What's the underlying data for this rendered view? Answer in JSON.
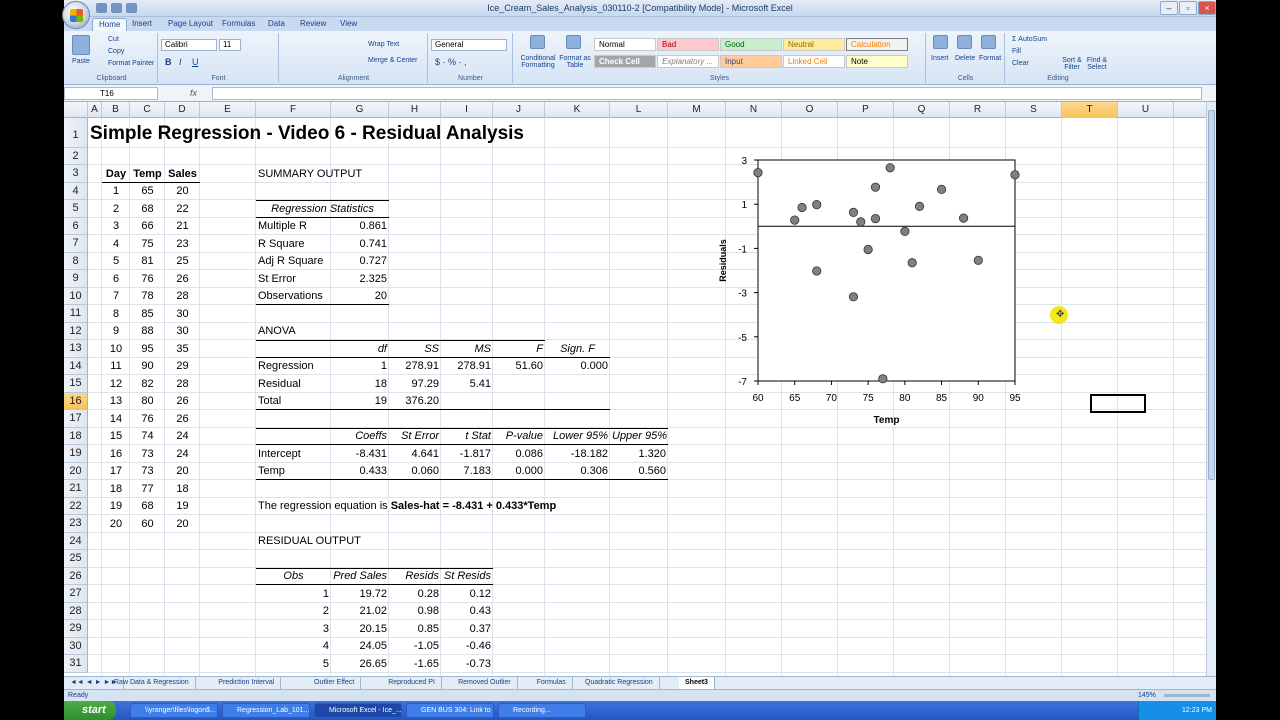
{
  "window": {
    "title": "Ice_Cream_Sales_Analysis_030110-2  [Compatibility Mode] - Microsoft Excel"
  },
  "ribbon_tabs": [
    "Home",
    "Insert",
    "Page Layout",
    "Formulas",
    "Data",
    "Review",
    "View"
  ],
  "ribbon": {
    "clipboard": {
      "paste": "Paste",
      "cut": "Cut",
      "copy": "Copy",
      "format_painter": "Format Painter",
      "label": "Clipboard"
    },
    "font": {
      "name": "Calibri",
      "size": "11",
      "label": "Font"
    },
    "alignment": {
      "wrap": "Wrap Text",
      "merge": "Merge & Center",
      "label": "Alignment"
    },
    "number": {
      "format": "General",
      "label": "Number"
    },
    "styles": {
      "conditional": "Conditional Formatting",
      "format_table": "Format as Table",
      "label": "Styles",
      "cells": [
        "Normal",
        "Bad",
        "Good",
        "Neutral",
        "Calculation",
        "Check Cell",
        "Explanatory ...",
        "Input",
        "Linked Cell",
        "Note"
      ]
    },
    "cells": {
      "insert": "Insert",
      "delete": "Delete",
      "format": "Format",
      "label": "Cells"
    },
    "editing": {
      "autosum": "AutoSum",
      "fill": "Fill",
      "clear": "Clear",
      "sort": "Sort & Filter",
      "find": "Find & Select",
      "label": "Editing"
    }
  },
  "formula_bar": {
    "name_box": "T16",
    "fx": "fx",
    "value": ""
  },
  "columns": [
    "A",
    "B",
    "C",
    "D",
    "E",
    "F",
    "G",
    "H",
    "I",
    "J",
    "K",
    "L",
    "M",
    "N",
    "O",
    "P",
    "Q",
    "R",
    "S",
    "T",
    "U"
  ],
  "selected_column": "T",
  "rows": [
    "1",
    "2",
    "3",
    "4",
    "5",
    "6",
    "7",
    "8",
    "9",
    "10",
    "11",
    "12",
    "13",
    "14",
    "15",
    "16",
    "17",
    "18",
    "19",
    "20",
    "21",
    "22",
    "23",
    "24",
    "25",
    "26",
    "27",
    "28",
    "29",
    "30",
    "31"
  ],
  "selected_row": "16",
  "sheet": {
    "title": "Simple Regression - Video 6 - Residual Analysis",
    "data_headers": [
      "Day",
      "Temp",
      "Sales"
    ],
    "data": [
      [
        "1",
        "65",
        "20"
      ],
      [
        "2",
        "68",
        "22"
      ],
      [
        "3",
        "66",
        "21"
      ],
      [
        "4",
        "75",
        "23"
      ],
      [
        "5",
        "81",
        "25"
      ],
      [
        "6",
        "76",
        "26"
      ],
      [
        "7",
        "78",
        "28"
      ],
      [
        "8",
        "85",
        "30"
      ],
      [
        "9",
        "88",
        "30"
      ],
      [
        "10",
        "95",
        "35"
      ],
      [
        "11",
        "90",
        "29"
      ],
      [
        "12",
        "82",
        "28"
      ],
      [
        "13",
        "80",
        "26"
      ],
      [
        "14",
        "76",
        "26"
      ],
      [
        "15",
        "74",
        "24"
      ],
      [
        "16",
        "73",
        "24"
      ],
      [
        "17",
        "73",
        "20"
      ],
      [
        "18",
        "77",
        "18"
      ],
      [
        "19",
        "68",
        "19"
      ],
      [
        "20",
        "60",
        "20"
      ]
    ],
    "summary_title": "SUMMARY OUTPUT",
    "reg_stats_title": "Regression Statistics",
    "reg_stats": [
      [
        "Multiple R",
        "0.861"
      ],
      [
        "R Square",
        "0.741"
      ],
      [
        "Adj R Square",
        "0.727"
      ],
      [
        "St Error",
        "2.325"
      ],
      [
        "Observations",
        "20"
      ]
    ],
    "anova_title": "ANOVA",
    "anova_headers": [
      "df",
      "SS",
      "MS",
      "F",
      "Sign. F"
    ],
    "anova": [
      [
        "Regression",
        "1",
        "278.91",
        "278.91",
        "51.60",
        "0.000"
      ],
      [
        "Residual",
        "18",
        "97.29",
        "5.41",
        "",
        ""
      ],
      [
        "Total",
        "19",
        "376.20",
        "",
        "",
        ""
      ]
    ],
    "coef_headers": [
      "Coeffs",
      "St Error",
      "t Stat",
      "P-value",
      "Lower 95%",
      "Upper 95%"
    ],
    "coefs": [
      [
        "Intercept",
        "-8.431",
        "4.641",
        "-1.817",
        "0.086",
        "-18.182",
        "1.320"
      ],
      [
        "Temp",
        "0.433",
        "0.060",
        "7.183",
        "0.000",
        "0.306",
        "0.560"
      ]
    ],
    "equation_prefix": "The regression equation is ",
    "equation": "Sales-hat = -8.431 + 0.433*Temp",
    "residual_title": "RESIDUAL OUTPUT",
    "residual_headers": [
      "Obs",
      "Pred Sales",
      "Resids",
      "St Resids"
    ],
    "residuals": [
      [
        "1",
        "19.72",
        "0.28",
        "0.12"
      ],
      [
        "2",
        "21.02",
        "0.98",
        "0.43"
      ],
      [
        "3",
        "20.15",
        "0.85",
        "0.37"
      ],
      [
        "4",
        "24.05",
        "-1.05",
        "-0.46"
      ],
      [
        "5",
        "26.65",
        "-1.65",
        "-0.73"
      ]
    ]
  },
  "chart_data": {
    "type": "scatter",
    "title": "",
    "xlabel": "Temp",
    "ylabel": "Residuals",
    "xlim": [
      60,
      95
    ],
    "ylim": [
      -7,
      3
    ],
    "xticks": [
      "60",
      "65",
      "70",
      "75",
      "80",
      "85",
      "90",
      "95"
    ],
    "yticks": [
      "3",
      "1",
      "-1",
      "-3",
      "-5",
      "-7"
    ],
    "points": [
      [
        65,
        0.28
      ],
      [
        68,
        0.98
      ],
      [
        66,
        0.85
      ],
      [
        75,
        -1.05
      ],
      [
        81,
        -1.65
      ],
      [
        76,
        0.35
      ],
      [
        78,
        2.65
      ],
      [
        85,
        1.67
      ],
      [
        88,
        0.37
      ],
      [
        95,
        2.33
      ],
      [
        90,
        -1.54
      ],
      [
        82,
        0.9
      ],
      [
        80,
        -0.23
      ],
      [
        76,
        1.77
      ],
      [
        74,
        0.2
      ],
      [
        73,
        0.63
      ],
      [
        73,
        -3.19
      ],
      [
        77,
        -6.9
      ],
      [
        68,
        -2.02
      ],
      [
        60,
        2.43
      ]
    ],
    "zero_line": 0,
    "marker_color": "#808080"
  },
  "sheet_tabs": [
    "Raw Data & Regression",
    "Prediction Interval",
    "Outlier Effect",
    "Reproduced PI",
    "Removed Outlier",
    "Formulas",
    "Quadratic Regression",
    "Sheet3"
  ],
  "active_sheet": "Sheet3",
  "status": {
    "ready": "Ready",
    "zoom": "145%"
  },
  "taskbar": {
    "start": "start",
    "items": [
      "\\\\yranger\\files\\logon$...",
      "Regression_Lab_101...",
      "Microsoft Excel - Ice_...",
      "GEN BUS 304: Link to ...",
      "Recording..."
    ],
    "active": 2,
    "clock": "12:23 PM"
  }
}
